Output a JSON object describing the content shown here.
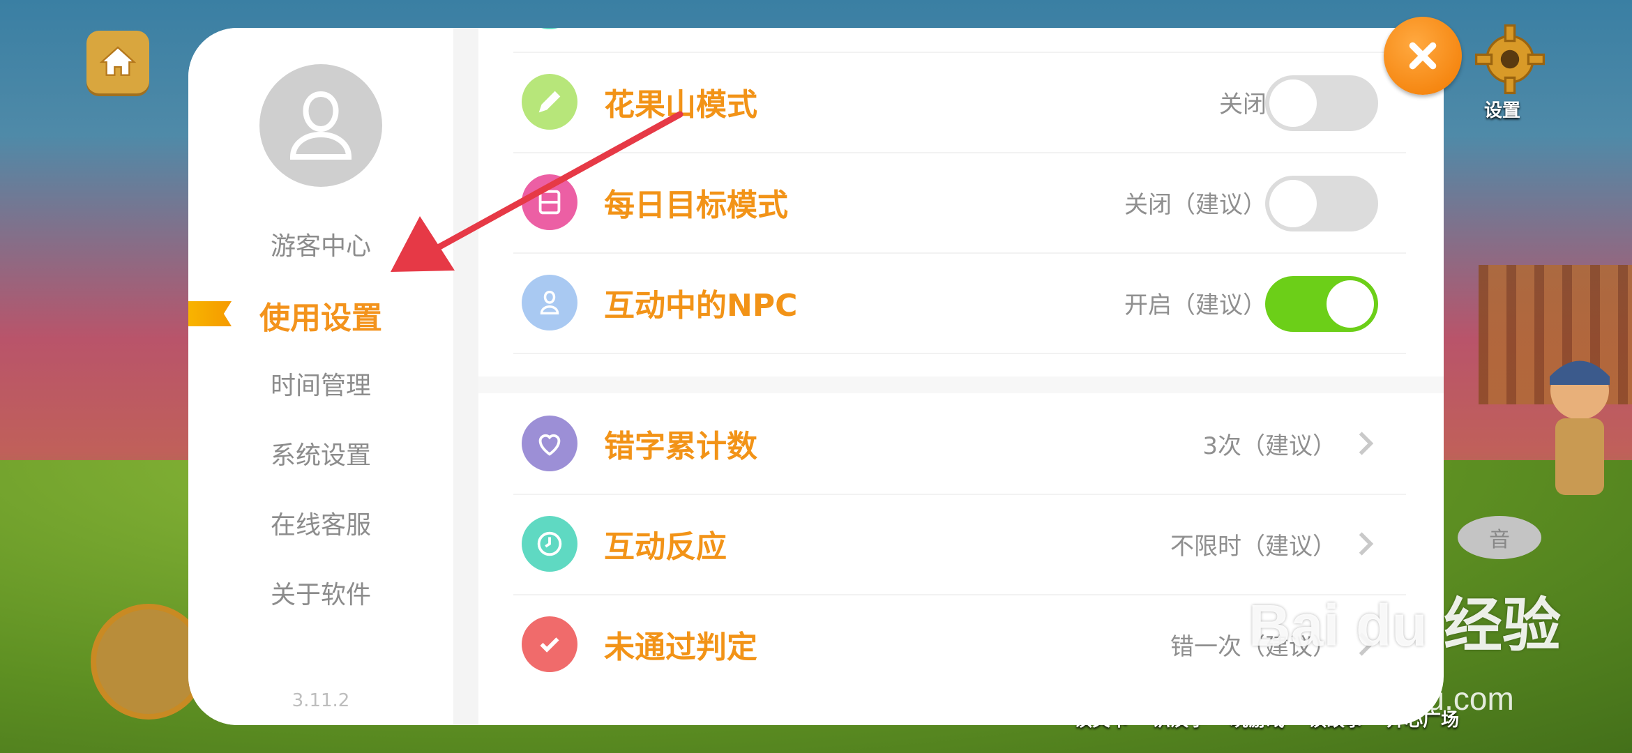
{
  "game": {
    "settings_label": "设置",
    "sound_label": "音",
    "bottom_tabs": [
      "读关卡",
      "识汉字",
      "玩游戏",
      "读故事",
      "开心广场"
    ]
  },
  "colors": {
    "accent": "#f29317",
    "toggle_on": "#6ccf18",
    "toggle_off": "#dcdcdc",
    "close_button": "#f58a0a"
  },
  "sidebar": {
    "items": [
      {
        "label": "游客中心",
        "active": false
      },
      {
        "label": "使用设置",
        "active": true
      },
      {
        "label": "时间管理",
        "active": false
      },
      {
        "label": "系统设置",
        "active": false
      },
      {
        "label": "在线客服",
        "active": false
      },
      {
        "label": "关于软件",
        "active": false
      }
    ],
    "version": "3.11.2"
  },
  "settings": {
    "rows": [
      {
        "title": "花果山模式",
        "value": "关闭",
        "control": "toggle",
        "on": false,
        "icon": "pen-icon",
        "icon_color": "#b7e67a"
      },
      {
        "title": "每日目标模式",
        "value": "关闭（建议）",
        "control": "toggle",
        "on": false,
        "icon": "calendar-icon",
        "icon_color": "#ec5fa4"
      },
      {
        "title": "互动中的NPC",
        "value": "开启（建议）",
        "control": "toggle",
        "on": true,
        "icon": "person-icon",
        "icon_color": "#a9c9f2"
      },
      {
        "title": "错字累计数",
        "value": "3次（建议）",
        "control": "nav",
        "icon": "heart-icon",
        "icon_color": "#9c8fd6"
      },
      {
        "title": "互动反应",
        "value": "不限时（建议）",
        "control": "nav",
        "icon": "clock-icon",
        "icon_color": "#5fd9c2"
      },
      {
        "title": "未通过判定",
        "value": "错一次（建议）",
        "control": "nav",
        "icon": "check-icon",
        "icon_color": "#f06b6b"
      }
    ]
  },
  "watermark": {
    "brand": "Bai du 经验",
    "url": "jingyan.baidu.com"
  }
}
